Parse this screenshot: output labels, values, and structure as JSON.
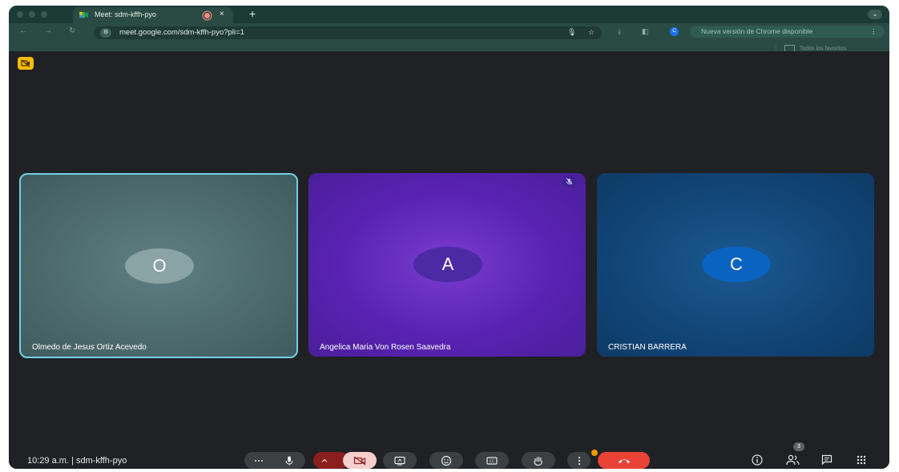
{
  "browser": {
    "tab_title": "Meet: sdm-kffh-pyo",
    "tab_close": "×",
    "new_tab": "+",
    "url": "meet.google.com/sdm-kffh-pyo?pli=1",
    "profile_initial": "C",
    "update_text": "Nueva versión de Chrome disponible",
    "update_menu": "⋮",
    "bookmarks_label": "Todos los favoritos"
  },
  "tiles": [
    {
      "initial": "O",
      "name": "Olmedo de Jesus Ortiz Acevedo"
    },
    {
      "initial": "A",
      "name": "Angelica Maria Von Rosen Saavedra"
    },
    {
      "initial": "C",
      "name": "CRISTIAN BARRERA"
    }
  ],
  "bottom": {
    "time_and_code": "10:29 a.m.  |  sdm-kffh-pyo",
    "participants_count": "3"
  },
  "icons": {
    "more_audio": "more-options-icon",
    "mic": "microphone-icon",
    "chevron": "chevron-up-icon",
    "camera": "camera-off-icon",
    "present": "present-screen-icon",
    "emoji": "emoji-icon",
    "captions": "captions-icon",
    "hand": "raise-hand-icon",
    "more": "more-vert-icon",
    "end": "end-call-icon",
    "info": "info-icon",
    "people": "people-icon",
    "chat": "chat-icon",
    "activities": "apps-grid-icon"
  },
  "colors": {
    "end_call": "#ea4335",
    "camera_off_bg": "#f6d0cd",
    "active_speaker_border": "#74cfe8",
    "hand_badge": "#f29900"
  }
}
